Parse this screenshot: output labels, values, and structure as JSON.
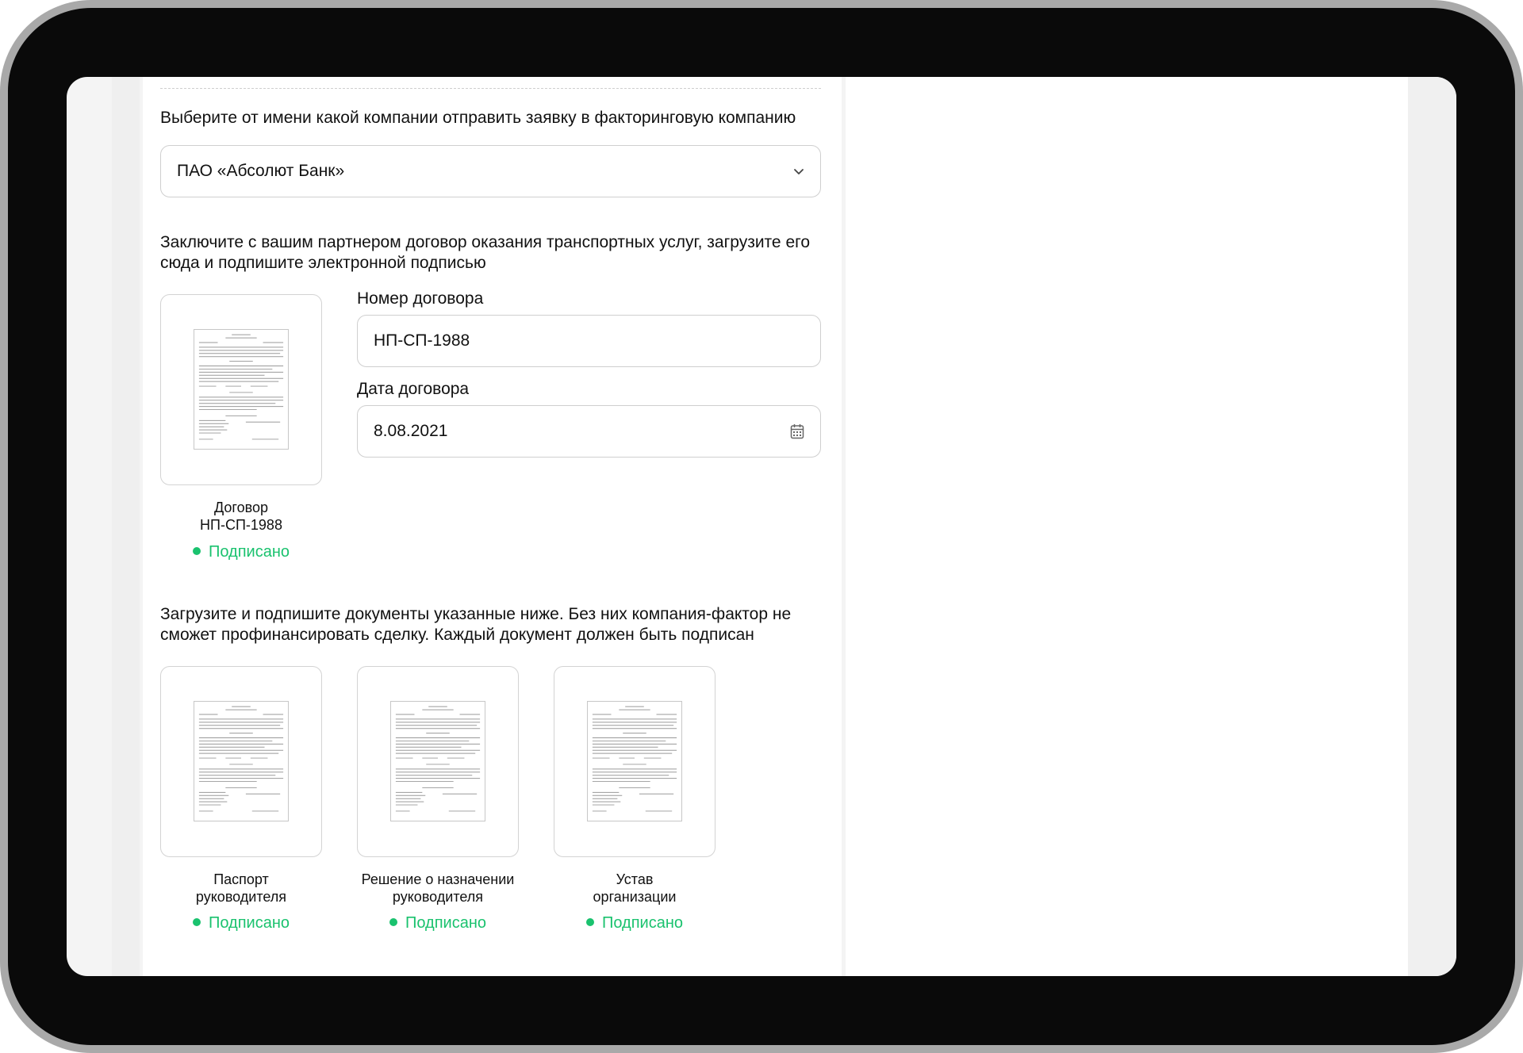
{
  "form": {
    "company_prompt": "Выберите от имени какой компании отправить заявку в факторинговую компанию",
    "company_select": {
      "value": "ПАО «Абсолют Банк»"
    },
    "contract_prompt": "Заключите с вашим партнером договор оказания транспортных услуг, загрузите его сюда и подпишите электронной подписью",
    "contract_number": {
      "label": "Номер договора",
      "value": "НП-СП-1988"
    },
    "contract_date": {
      "label": "Дата договора",
      "value": "8.08.2021"
    },
    "contract_doc": {
      "caption_line1": "Договор",
      "caption_line2": "НП-СП-1988",
      "status": "Подписано"
    },
    "docs_prompt": "Загрузите и подпишите документы указанные ниже. Без них компания-фактор не сможет профинансировать сделку. Каждый документ должен быть подписан",
    "documents": [
      {
        "caption_line1": "Паспорт",
        "caption_line2": "руководителя",
        "status": "Подписано"
      },
      {
        "caption_line1": "Решение о назначении",
        "caption_line2": "руководителя",
        "status": "Подписано"
      },
      {
        "caption_line1": "Устав",
        "caption_line2": "организации",
        "status": "Подписано"
      }
    ]
  },
  "colors": {
    "accent_green": "#1ac26e",
    "border": "#cfcfcf",
    "device_frame": "#0a0a0a"
  },
  "icons": {
    "select": "chevron-down-icon",
    "date": "calendar-icon",
    "status": "status-dot-icon"
  }
}
